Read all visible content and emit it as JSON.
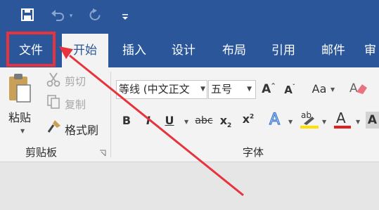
{
  "qat": {
    "save_icon": "save-icon",
    "undo_icon": "undo-icon",
    "redo_icon": "redo-icon",
    "customize_icon": "customize-qat-icon"
  },
  "tabs": [
    {
      "label": "文件"
    },
    {
      "label": "开始"
    },
    {
      "label": "插入"
    },
    {
      "label": "设计"
    },
    {
      "label": "布局"
    },
    {
      "label": "引用"
    },
    {
      "label": "邮件"
    },
    {
      "label": "审"
    }
  ],
  "clipboard": {
    "paste_label": "粘贴",
    "cut_label": "剪切",
    "copy_label": "复制",
    "format_painter_label": "格式刷",
    "group_label": "剪贴板"
  },
  "font": {
    "font_name": "等线 (中文正文",
    "font_size": "五号",
    "group_label": "字体",
    "case_label": "Aa",
    "strike_label": "abc",
    "bold_label": "B",
    "italic_label": "I",
    "underline_label": "U",
    "grow_label": "A",
    "shrink_label": "A",
    "effects_label": "A",
    "highlight_label": "ab",
    "color_label": "A",
    "shade_label": "A"
  },
  "colors": {
    "accent": "#2b579a",
    "annotation_red": "#e8323c",
    "highlight_yellow": "#ffe000",
    "font_color_red": "#e02020"
  }
}
